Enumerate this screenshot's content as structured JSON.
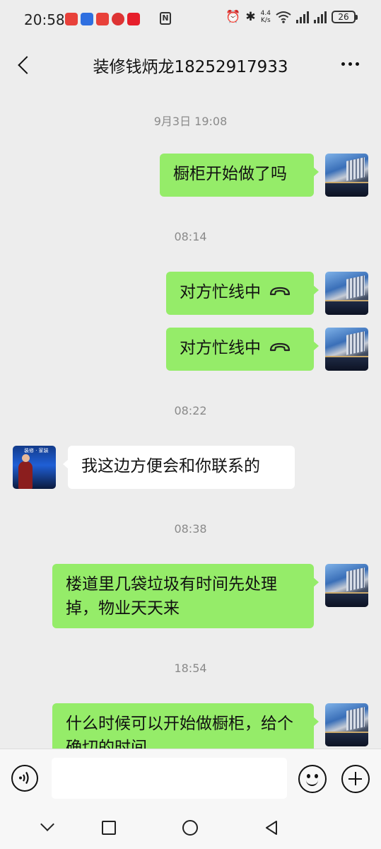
{
  "status_bar": {
    "time": "20:58",
    "network_speed": "4.4\nK/s",
    "battery": "26",
    "icons": [
      "notification-app-icon",
      "notification-app-icon",
      "notification-app-icon",
      "notification-app-icon",
      "notification-app-icon",
      "nfc-icon",
      "alarm-icon",
      "bluetooth-icon",
      "wifi-icon",
      "signal-icon",
      "signal-icon",
      "battery-icon"
    ]
  },
  "header": {
    "title": "装修钱炳龙18252917933",
    "back_icon": "chevron-left-icon",
    "more_icon": "more-dots-icon"
  },
  "messages": [
    {
      "type": "time",
      "text": "9月3日 19:08"
    },
    {
      "type": "msg",
      "from": "me",
      "text": "橱柜开始做了吗"
    },
    {
      "type": "time",
      "text": "08:14"
    },
    {
      "type": "call",
      "from": "me",
      "text": "对方忙线中",
      "icon": "phone-hangup-icon"
    },
    {
      "type": "call",
      "from": "me",
      "text": "对方忙线中",
      "icon": "phone-hangup-icon"
    },
    {
      "type": "time",
      "text": "08:22"
    },
    {
      "type": "msg",
      "from": "other",
      "text": "我这边方便会和你联系的",
      "avatar_text": "装修 · 家装"
    },
    {
      "type": "time",
      "text": "08:38"
    },
    {
      "type": "msg",
      "from": "me",
      "text": "楼道里几袋垃圾有时间先处理掉，物业天天来"
    },
    {
      "type": "time",
      "text": "18:54"
    },
    {
      "type": "msg",
      "from": "me",
      "text": "什么时候可以开始做橱柜，给个确切的时间"
    }
  ],
  "input_bar": {
    "voice_icon": "voice-icon",
    "input_value": "",
    "emoji_icon": "emoji-icon",
    "plus_icon": "plus-icon"
  },
  "nav_bar": {
    "icons": [
      "nav-down-icon",
      "nav-recents-icon",
      "nav-home-icon",
      "nav-back-icon"
    ]
  },
  "colors": {
    "background": "#ededed",
    "my_bubble": "#95ec69",
    "other_bubble": "#ffffff",
    "timestamp": "#8a8a8a"
  }
}
